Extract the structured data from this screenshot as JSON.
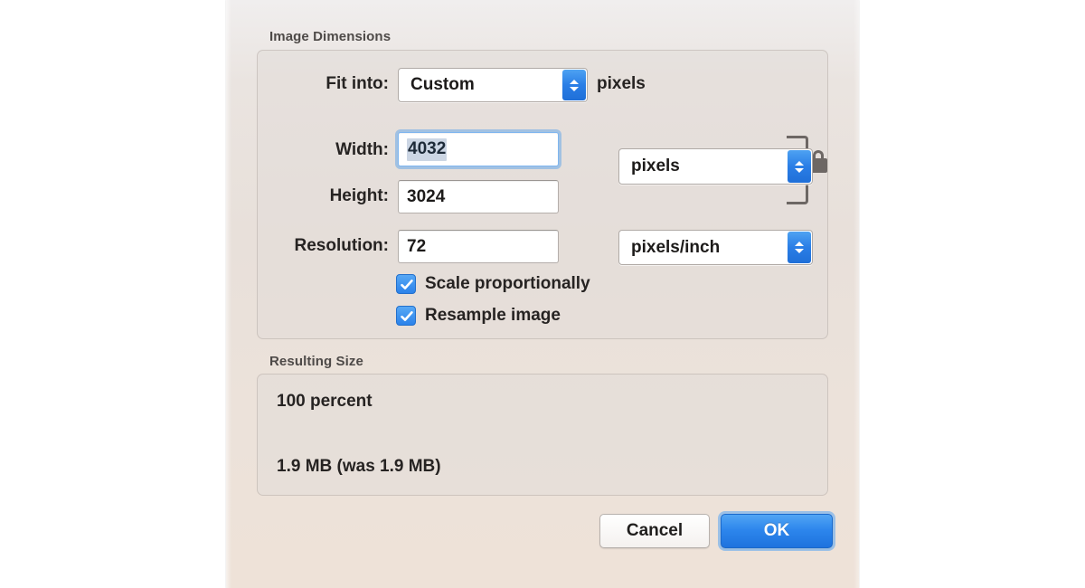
{
  "dialog": {
    "sections": {
      "image_dimensions_caption": "Image Dimensions",
      "resulting_size_caption": "Resulting Size"
    },
    "fit_into": {
      "label": "Fit into:",
      "value": "Custom",
      "suffix": "pixels"
    },
    "width": {
      "label": "Width:",
      "value": "4032",
      "selected": true
    },
    "height": {
      "label": "Height:",
      "value": "3024"
    },
    "units": {
      "value": "pixels"
    },
    "resolution": {
      "label": "Resolution:",
      "value": "72",
      "units": "pixels/inch"
    },
    "link_lock": {
      "icon": "lock-closed-icon"
    },
    "checkboxes": [
      {
        "label": "Scale proportionally",
        "checked": true
      },
      {
        "label": "Resample image",
        "checked": true
      }
    ],
    "resulting_size": {
      "percent": "100 percent",
      "size": "1.9 MB (was 1.9 MB)"
    },
    "buttons": {
      "cancel": "Cancel",
      "ok": "OK"
    }
  },
  "cursor": {
    "icon": "arrow-pointer-icon"
  },
  "colors": {
    "accent_blue": "#2c85ec",
    "stepper_blue": "#2a7ee6",
    "checkbox_blue": "#2b82ea",
    "focus_ring": "#7fb6ef",
    "selection_highlight": "#ccd6e4",
    "dialog_bg": "#eae2dc",
    "group_border": "#a09691",
    "label_text": "#262322",
    "caption_text": "#4e4a48"
  }
}
